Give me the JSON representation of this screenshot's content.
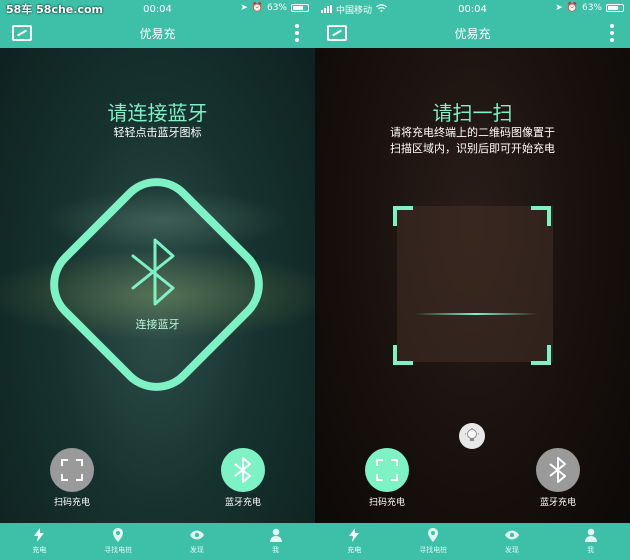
{
  "watermark": "58车 58che.com",
  "colors": {
    "accent": "#7ff2c5",
    "bar": "#3dbfa8"
  },
  "left": {
    "status": {
      "time": "00:04",
      "battery": "63%"
    },
    "nav": {
      "title": "优易充"
    },
    "heading": "请连接蓝牙",
    "subheading": "轻轻点击蓝牙图标",
    "bluetooth_caption": "连接蓝牙",
    "buttons": {
      "scan_label": "扫码充电",
      "bluetooth_label": "蓝牙充电"
    }
  },
  "right": {
    "status": {
      "carrier": "中国移动",
      "time": "00:04",
      "battery": "63%"
    },
    "nav": {
      "title": "优易充"
    },
    "heading": "请扫一扫",
    "sub_line1": "请将充电终端上的二维码图像置于",
    "sub_line2": "扫描区域内，识别后即可开始充电",
    "buttons": {
      "scan_label": "扫码充电",
      "bluetooth_label": "蓝牙充电"
    }
  },
  "tabs": [
    {
      "label": "充电",
      "icon": "bolt-icon"
    },
    {
      "label": "寻找电桩",
      "icon": "location-pin-icon"
    },
    {
      "label": "发现",
      "icon": "eye-icon"
    },
    {
      "label": "我",
      "icon": "person-icon"
    }
  ]
}
